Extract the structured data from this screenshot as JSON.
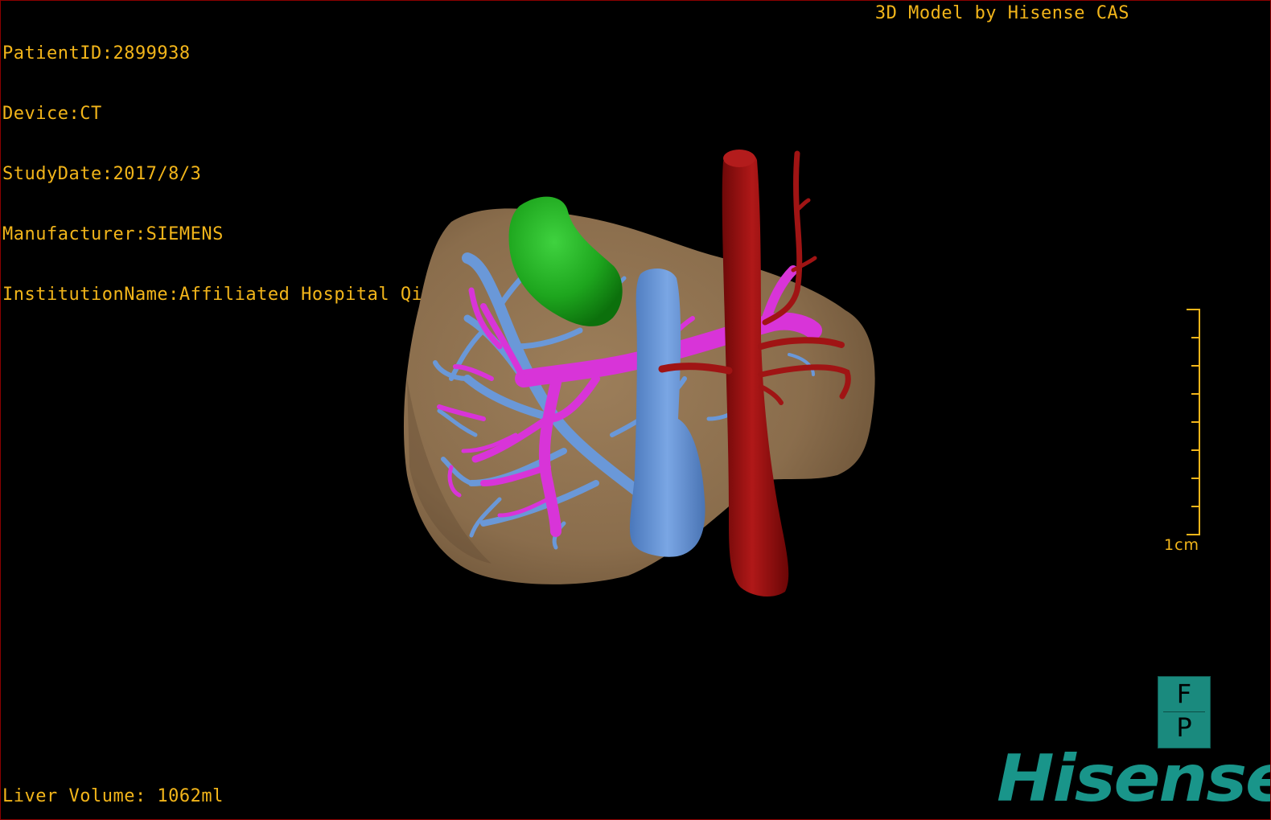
{
  "study_info": {
    "patient_id": "PatientID:2899938",
    "device": "Device:CT",
    "study_date": "StudyDate:2017/8/3",
    "manufacturer": "Manufacturer:SIEMENS",
    "institution": "InstitutionName:Affiliated Hospital Qingdao University-C"
  },
  "model_label": "3D Model by Hisense CAS",
  "liver_volume": "Liver Volume: 1062ml",
  "scale": {
    "label": "1cm",
    "ticks": 9
  },
  "orientation": {
    "top": "F",
    "bottom": "P"
  },
  "brand": "Hisense",
  "colors": {
    "text": "#f2b51a",
    "liver": "#8d7150",
    "gallbladder": "#1ea61e",
    "portal_vein": "#6a98d8",
    "hepatic_vein": "#d834d8",
    "aorta": "#9b1010",
    "orient_box": "#1a8a7e",
    "brand": "#19958a",
    "border": "#8a0000"
  }
}
